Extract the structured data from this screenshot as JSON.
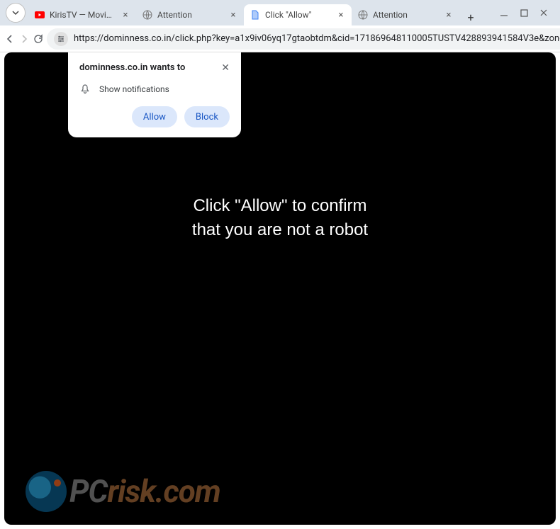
{
  "window": {
    "tabs": [
      {
        "title": "KirisTV — Movies and S",
        "active": false,
        "icon": "youtube"
      },
      {
        "title": "Attention",
        "active": false,
        "icon": "globe"
      },
      {
        "title": "Click \"Allow\"",
        "active": true,
        "icon": "page"
      },
      {
        "title": "Attention",
        "active": false,
        "icon": "globe"
      }
    ]
  },
  "toolbar": {
    "url_display": "https://dominness.co.in/click.php?key=a1x9iv06yq17gtaobtdm&cid=171869648110005TUSTV428893941584V3e&zone=..."
  },
  "permission": {
    "title": "dominness.co.in wants to",
    "body": "Show notifications",
    "allow": "Allow",
    "block": "Block"
  },
  "page": {
    "message": "Click \"Allow\" to confirm\nthat you are not a robot"
  },
  "watermark": {
    "text_left": "PC",
    "text_right": "risk.com"
  }
}
